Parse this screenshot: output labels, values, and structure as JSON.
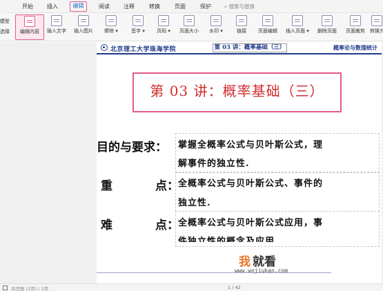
{
  "menu": {
    "items": [
      "开始",
      "插入",
      "编辑",
      "阅读",
      "注释",
      "转换",
      "页面",
      "保护"
    ],
    "active": "编辑",
    "search_placeholder": "搜索与替换"
  },
  "sidebar_left": {
    "label_1": "模型",
    "label_2": "选择"
  },
  "toolbar": {
    "tools": [
      {
        "label": "编辑内容",
        "icon": "edit-content-icon"
      },
      {
        "label": "插入文字",
        "icon": "insert-text-icon"
      },
      {
        "label": "插入图片",
        "icon": "insert-image-icon"
      },
      {
        "label": "擦除 ▾",
        "icon": "eraser-icon"
      },
      {
        "label": "签字 ▾",
        "icon": "signature-icon"
      },
      {
        "label": "页码 ▾",
        "icon": "page-number-icon"
      },
      {
        "label": "页面大小",
        "icon": "page-size-icon"
      },
      {
        "label": "水印 ▾",
        "icon": "watermark-icon"
      },
      {
        "label": "链接",
        "icon": "link-icon"
      },
      {
        "label": "页面编辑",
        "icon": "page-edit-icon"
      },
      {
        "label": "插入页面 ▾",
        "icon": "insert-page-icon"
      },
      {
        "label": "删除页面",
        "icon": "delete-page-icon"
      },
      {
        "label": "页面裁剪",
        "icon": "page-crop-icon"
      },
      {
        "label": "转换为",
        "icon": "convert-icon"
      }
    ]
  },
  "document": {
    "header": {
      "school": "北京理工大学珠海学院",
      "lecture": "第 03 讲：概率基础（三）",
      "course": "概率论与数理统计"
    },
    "title": "第 03 讲：概率基础（三）",
    "rows": [
      {
        "label": "目的与要求：",
        "lines": [
          "掌握全概率公式与贝叶斯公式，理",
          "解事件的独立性."
        ]
      },
      {
        "label_a": "重",
        "label_b": "点：",
        "lines": [
          "全概率公式与贝叶斯公式、事件的",
          "独立性."
        ]
      },
      {
        "label_a": "难",
        "label_b": "点：",
        "lines": [
          "全概率公式与贝叶斯公式应用，事",
          "件独立性的概念及应用"
        ]
      }
    ]
  },
  "watermark": {
    "char1": "我",
    "rest": "就看",
    "url": "www.wojiukan.com"
  },
  "status": {
    "text": "共页数 (2页) / 2页",
    "page": "1 / 42"
  }
}
